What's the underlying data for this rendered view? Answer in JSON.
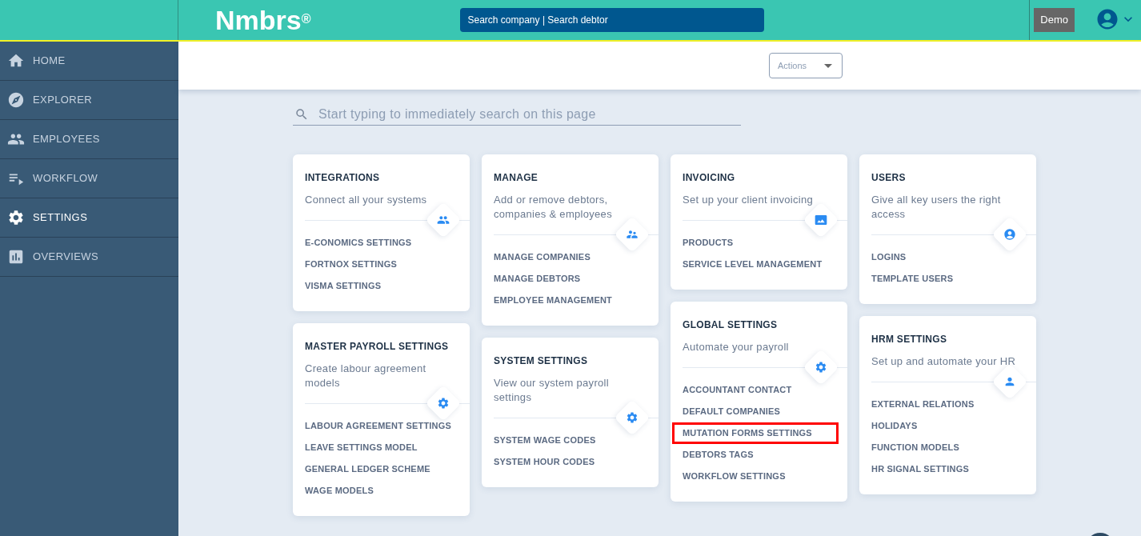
{
  "header": {
    "logo": "Nmbrs$^{®}$",
    "search": "Search company | Search debtor",
    "demo_button": "Demo"
  },
  "sidebar": {
    "items": [
      {
        "label": "HOME",
        "selected": false
      },
      {
        "label": "EXPLORER",
        "selected": false
      },
      {
        "label": "EMPLOYEES",
        "selected": false
      },
      {
        "label": "WORKFLOW",
        "selected": false
      },
      {
        "label": "SETTINGS",
        "selected": true
      },
      {
        "label": "OVERVIEWS",
        "selected": false
      }
    ]
  },
  "toolbar": {
    "actions": "Actions"
  },
  "page_search": {
    "placeholder": "Start typing to immediately search on this page"
  },
  "columns": [
    {
      "cards": [
        {
          "title": "INTEGRATIONS",
          "description": "Connect all your systems",
          "links": [
            {
              "label": "E-CONOMICS SETTINGS",
              "highlighted": false
            },
            {
              "label": "FORTNOX SETTINGS",
              "highlighted": false
            },
            {
              "label": "VISMA SETTINGS",
              "highlighted": false
            }
          ]
        },
        {
          "title": "MASTER PAYROLL SETTINGS",
          "description": "Create labour agreement models",
          "links": [
            {
              "label": "LABOUR AGREEMENT SETTINGS",
              "highlighted": false
            },
            {
              "label": "LEAVE SETTINGS MODEL",
              "highlighted": false
            },
            {
              "label": "GENERAL LEDGER SCHEME",
              "highlighted": false
            },
            {
              "label": "WAGE MODELS",
              "highlighted": false
            }
          ]
        }
      ]
    },
    {
      "cards": [
        {
          "title": "MANAGE",
          "description": "Add or remove debtors, companies & employees",
          "links": [
            {
              "label": "MANAGE COMPANIES",
              "highlighted": false
            },
            {
              "label": "MANAGE DEBTORS",
              "highlighted": false
            },
            {
              "label": "EMPLOYEE MANAGEMENT",
              "highlighted": false
            }
          ]
        },
        {
          "title": "SYSTEM SETTINGS",
          "description": "View our system payroll settings",
          "links": [
            {
              "label": "SYSTEM WAGE CODES",
              "highlighted": false
            },
            {
              "label": "SYSTEM HOUR CODES",
              "highlighted": false
            }
          ]
        }
      ]
    },
    {
      "cards": [
        {
          "title": "INVOICING",
          "description": "Set up your client invoicing",
          "links": [
            {
              "label": "PRODUCTS",
              "highlighted": false
            },
            {
              "label": "SERVICE LEVEL MANAGEMENT",
              "highlighted": false
            }
          ]
        },
        {
          "title": "GLOBAL SETTINGS",
          "description": "Automate your payroll",
          "links": [
            {
              "label": "ACCOUNTANT CONTACT",
              "highlighted": false
            },
            {
              "label": "DEFAULT COMPANIES",
              "highlighted": false
            },
            {
              "label": "MUTATION FORMS SETTINGS",
              "highlighted": true
            },
            {
              "label": "DEBTORS TAGS",
              "highlighted": false
            },
            {
              "label": "WORKFLOW SETTINGS",
              "highlighted": false
            }
          ]
        }
      ]
    },
    {
      "cards": [
        {
          "title": "USERS",
          "description": "Give all key users the right access",
          "links": [
            {
              "label": "LOGINS",
              "highlighted": false
            },
            {
              "label": "TEMPLATE USERS",
              "highlighted": false
            }
          ]
        },
        {
          "title": "HRM SETTINGS",
          "description": "Set up and automate your HR",
          "links": [
            {
              "label": "EXTERNAL RELATIONS",
              "highlighted": false
            },
            {
              "label": "HOLIDAYS",
              "highlighted": false
            },
            {
              "label": "FUNCTION MODELS",
              "highlighted": false
            },
            {
              "label": "HR SIGNAL SETTINGS",
              "highlighted": false
            }
          ]
        }
      ]
    }
  ]
}
